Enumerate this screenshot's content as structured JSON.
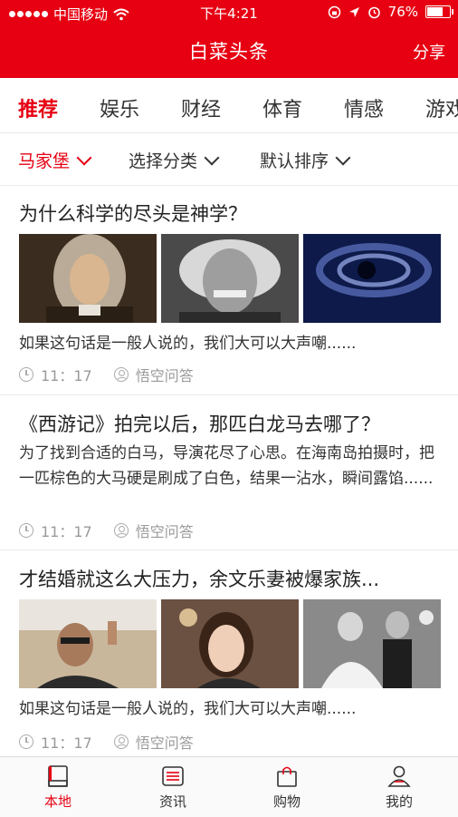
{
  "status": {
    "carrier": "中国移动",
    "time": "下午4:21",
    "battery": "76%",
    "battery_level": 0.76
  },
  "header": {
    "title": "白菜头条",
    "share_label": "分享"
  },
  "categories": [
    "推荐",
    "娱乐",
    "财经",
    "体育",
    "情感",
    "游戏"
  ],
  "active_category": 0,
  "filters": {
    "location": "马家堡",
    "category": "选择分类",
    "sort": "默认排序"
  },
  "articles": [
    {
      "title": "为什么科学的尽头是神学？",
      "summary": "如果这句话是一般人说的，我们大可以大声嘲......",
      "time": "11：17",
      "source": "悟空问答"
    },
    {
      "title": "《西游记》拍完以后，那匹白龙马去哪了？",
      "summary": "为了找到合适的白马，导演花尽了心思。在海南岛拍摄时，把一匹棕色的大马硬是刷成了白色，结果一沾水，瞬间露馅......",
      "time": "11：17",
      "source": "悟空问答"
    },
    {
      "title": "才结婚就这么大压力，余文乐妻被爆家族...",
      "summary": "如果这句话是一般人说的，我们大可以大声嘲......",
      "time": "11：17",
      "source": "悟空问答"
    }
  ],
  "tabbar": [
    {
      "label": "本地",
      "icon": "book-icon"
    },
    {
      "label": "资讯",
      "icon": "news-icon"
    },
    {
      "label": "购物",
      "icon": "shopping-bag-icon"
    },
    {
      "label": "我的",
      "icon": "user-icon"
    }
  ],
  "colors": {
    "brand": "#e60012",
    "muted": "#9a9a9a"
  }
}
